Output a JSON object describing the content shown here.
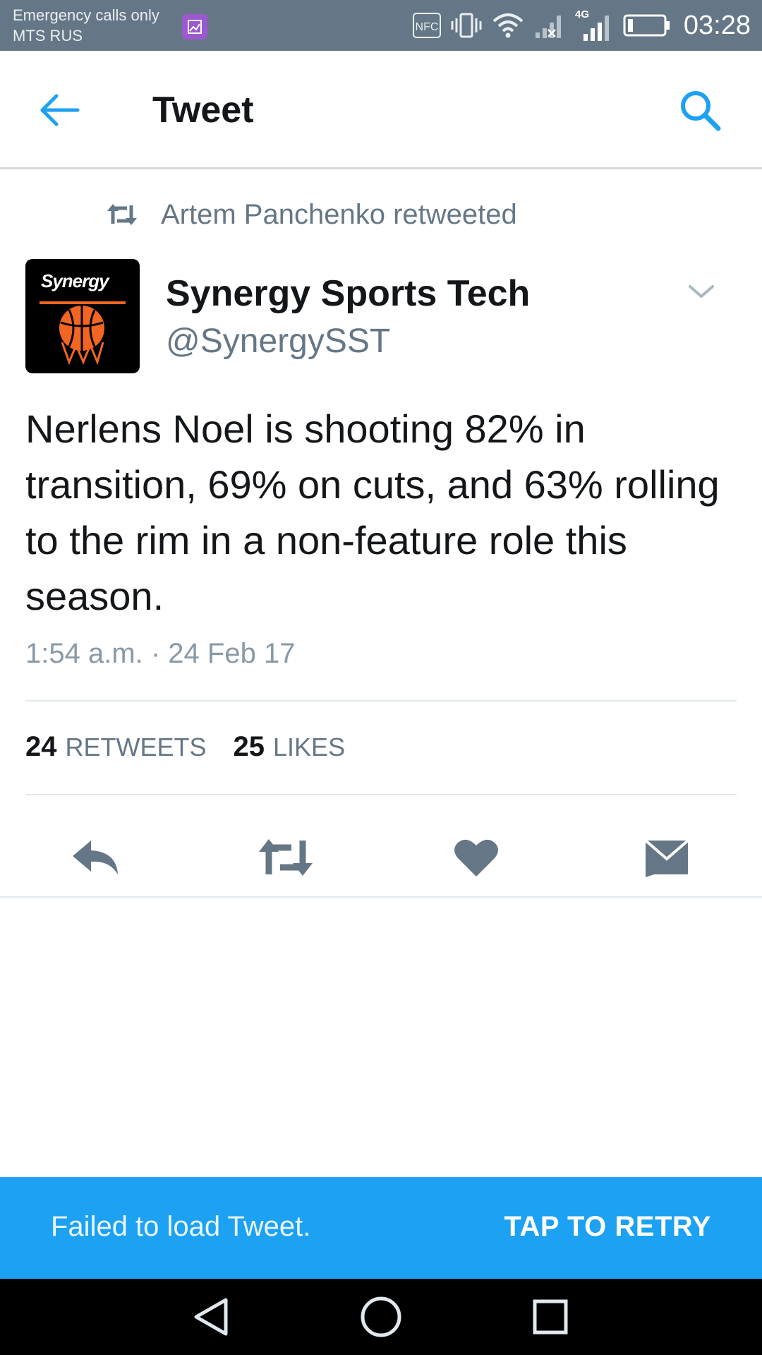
{
  "status_bar": {
    "line1": "Emergency calls only",
    "line2": "MTS RUS",
    "network_label": "4G",
    "nfc_label": "NFC",
    "time": "03:28",
    "icons": [
      "gallery-notification-icon",
      "nfc-icon",
      "vibrate-icon",
      "wifi-icon",
      "no-signal-icon",
      "signal-icon",
      "battery-icon"
    ]
  },
  "app_bar": {
    "title": "Tweet",
    "back_icon": "arrow-left-icon",
    "search_icon": "search-icon"
  },
  "tweet": {
    "retweeted_by": "Artem Panchenko retweeted",
    "avatar_logo_text": "Synergy",
    "author_name": "Synergy Sports Tech",
    "author_handle": "@SynergySST",
    "text": "Nerlens Noel is shooting 82% in transition, 69% on cuts, and 63% rolling to the rim in a non-feature role this season.",
    "timestamp": "1:54 a.m. · 24 Feb 17",
    "retweets_count": "24",
    "retweets_label": "RETWEETS",
    "likes_count": "25",
    "likes_label": "LIKES"
  },
  "actions": [
    "reply-icon",
    "retweet-icon",
    "like-icon",
    "direct-message-icon"
  ],
  "snackbar": {
    "message": "Failed to load Tweet.",
    "action": "TAP TO RETRY"
  },
  "nav_bar": [
    "back-triangle-icon",
    "home-circle-icon",
    "recents-square-icon"
  ],
  "colors": {
    "status_bar": "#657786",
    "accent": "#1da1f2",
    "text_primary": "#14171a",
    "text_secondary": "#657786",
    "action_icon": "#657786",
    "avatar_orange": "#f26522"
  }
}
